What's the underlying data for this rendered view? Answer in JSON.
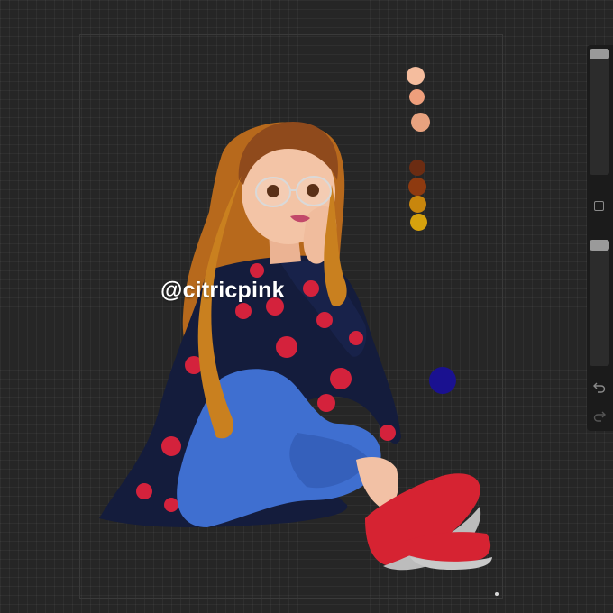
{
  "artwork": {
    "watermark": "@citricpink"
  },
  "palette": {
    "swatches": [
      "#f5bd9e",
      "#ef9f7c",
      "#e8a27f",
      "#6b2c12",
      "#8e3a10",
      "#c8860d",
      "#d6a20d"
    ],
    "loose_color": "#1a1190"
  },
  "side_panel": {
    "brush_size_level": 0.0,
    "opacity_level": 0.0,
    "icons": [
      "modify-square-icon",
      "undo-icon",
      "redo-icon"
    ]
  },
  "colors": {
    "background": "#262626",
    "panel": "#1b1b1b",
    "slider_thumb": "#9a9a9a"
  }
}
